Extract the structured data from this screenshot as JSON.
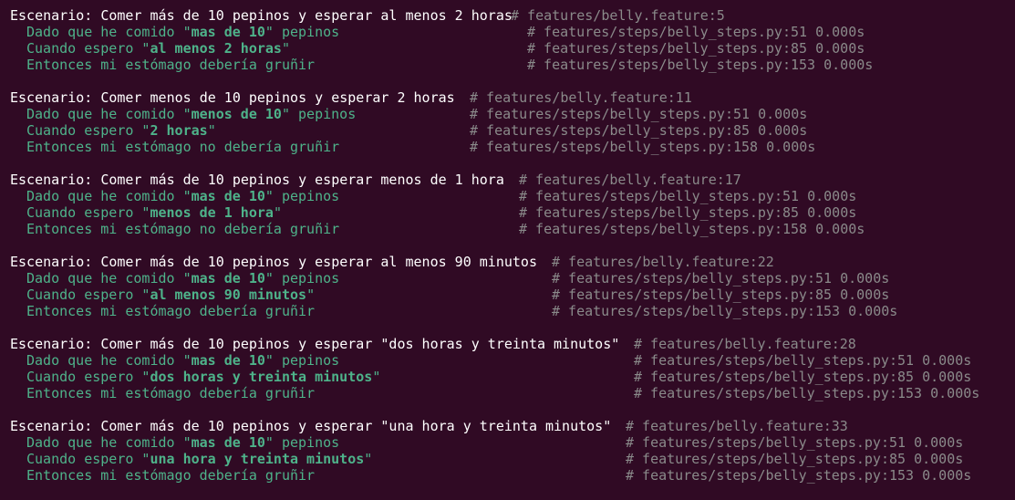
{
  "scenarios": [
    {
      "title": "Escenario: Comer más de 10 pepinos y esperar al menos 2 horas",
      "location": "# features/belly.feature:5",
      "steps": [
        {
          "pre": "Dado que he comido \"",
          "arg": "mas de 10",
          "post": "\" pepinos",
          "location": "# features/steps/belly_steps.py:51 0.000s"
        },
        {
          "pre": "Cuando espero \"",
          "arg": "al menos 2 horas",
          "post": "\"",
          "location": "# features/steps/belly_steps.py:85 0.000s"
        },
        {
          "pre": "Entonces mi estómago debería gruñir",
          "arg": "",
          "post": "",
          "location": "# features/steps/belly_steps.py:153 0.000s"
        }
      ]
    },
    {
      "title": "Escenario: Comer menos de 10 pepinos y esperar 2 horas",
      "location": "# features/belly.feature:11",
      "steps": [
        {
          "pre": "Dado que he comido \"",
          "arg": "menos de 10",
          "post": "\" pepinos",
          "location": "# features/steps/belly_steps.py:51 0.000s"
        },
        {
          "pre": "Cuando espero \"",
          "arg": "2 horas",
          "post": "\"",
          "location": "# features/steps/belly_steps.py:85 0.000s"
        },
        {
          "pre": "Entonces mi estómago no debería gruñir",
          "arg": "",
          "post": "",
          "location": "# features/steps/belly_steps.py:158 0.000s"
        }
      ]
    },
    {
      "title": "Escenario: Comer más de 10 pepinos y esperar menos de 1 hora",
      "location": "# features/belly.feature:17",
      "steps": [
        {
          "pre": "Dado que he comido \"",
          "arg": "mas de 10",
          "post": "\" pepinos",
          "location": "# features/steps/belly_steps.py:51 0.000s"
        },
        {
          "pre": "Cuando espero \"",
          "arg": "menos de 1 hora",
          "post": "\"",
          "location": "# features/steps/belly_steps.py:85 0.000s"
        },
        {
          "pre": "Entonces mi estómago no debería gruñir",
          "arg": "",
          "post": "",
          "location": "# features/steps/belly_steps.py:158 0.000s"
        }
      ]
    },
    {
      "title": "Escenario: Comer más de 10 pepinos y esperar al menos 90 minutos",
      "location": "# features/belly.feature:22",
      "steps": [
        {
          "pre": "Dado que he comido \"",
          "arg": "mas de 10",
          "post": "\" pepinos",
          "location": "# features/steps/belly_steps.py:51 0.000s"
        },
        {
          "pre": "Cuando espero \"",
          "arg": "al menos 90 minutos",
          "post": "\"",
          "location": "# features/steps/belly_steps.py:85 0.000s"
        },
        {
          "pre": "Entonces mi estómago debería gruñir",
          "arg": "",
          "post": "",
          "location": "# features/steps/belly_steps.py:153 0.000s"
        }
      ]
    },
    {
      "title": "Escenario: Comer más de 10 pepinos y esperar \"dos horas y treinta minutos\"",
      "location": "# features/belly.feature:28",
      "steps": [
        {
          "pre": "Dado que he comido \"",
          "arg": "mas de 10",
          "post": "\" pepinos",
          "location": "# features/steps/belly_steps.py:51 0.000s"
        },
        {
          "pre": "Cuando espero \"",
          "arg": "dos horas y treinta minutos",
          "post": "\"",
          "location": "# features/steps/belly_steps.py:85 0.000s"
        },
        {
          "pre": "Entonces mi estómago debería gruñir",
          "arg": "",
          "post": "",
          "location": "# features/steps/belly_steps.py:153 0.000s"
        }
      ]
    },
    {
      "title": "Escenario: Comer más de 10 pepinos y esperar \"una hora y treinta minutos\"",
      "location": "# features/belly.feature:33",
      "steps": [
        {
          "pre": "Dado que he comido \"",
          "arg": "mas de 10",
          "post": "\" pepinos",
          "location": "# features/steps/belly_steps.py:51 0.000s"
        },
        {
          "pre": "Cuando espero \"",
          "arg": "una hora y treinta minutos",
          "post": "\"",
          "location": "# features/steps/belly_steps.py:85 0.000s"
        },
        {
          "pre": "Entonces mi estómago debería gruñir",
          "arg": "",
          "post": "",
          "location": "# features/steps/belly_steps.py:153 0.000s"
        }
      ]
    }
  ],
  "colors": {
    "background": "#300a24",
    "title": "#ffffff",
    "step": "#4eb38a",
    "comment": "#8a8a8a"
  }
}
